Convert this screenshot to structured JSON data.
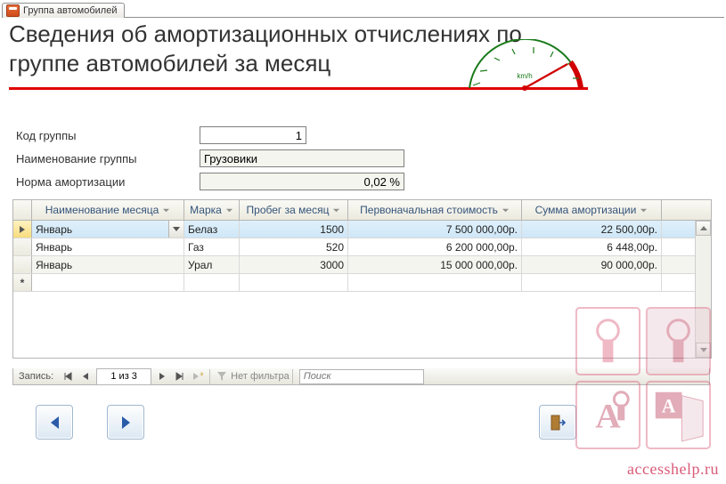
{
  "tab": {
    "label": "Группа автомобилей"
  },
  "title": "Сведения об амортизационных отчислениях по группе автомобилей за месяц",
  "speedo_unit": "km/h",
  "fields": {
    "group_code": {
      "label": "Код группы",
      "value": "1"
    },
    "group_name": {
      "label": "Наименование группы",
      "value": "Грузовики"
    },
    "amort_rate": {
      "label": "Норма амортизации",
      "value": "0,02 %"
    }
  },
  "grid": {
    "headers": {
      "month": "Наименование месяца",
      "brand": "Марка",
      "mileage": "Пробег за месяц",
      "cost": "Первоначальная стоимость",
      "amort": "Сумма амортизации"
    },
    "rows": [
      {
        "month": "Январь",
        "brand": "Белаз",
        "mileage": "1500",
        "cost": "7 500 000,00р.",
        "amort": "22 500,00р."
      },
      {
        "month": "Январь",
        "brand": "Газ",
        "mileage": "520",
        "cost": "6 200 000,00р.",
        "amort": "6 448,00р."
      },
      {
        "month": "Январь",
        "brand": "Урал",
        "mileage": "3000",
        "cost": "15 000 000,00р.",
        "amort": "90 000,00р."
      }
    ]
  },
  "recnav": {
    "label": "Запись:",
    "position": "1 из 3",
    "no_filter": "Нет фильтра",
    "search_placeholder": "Поиск"
  },
  "watermark": "accesshelp.ru"
}
